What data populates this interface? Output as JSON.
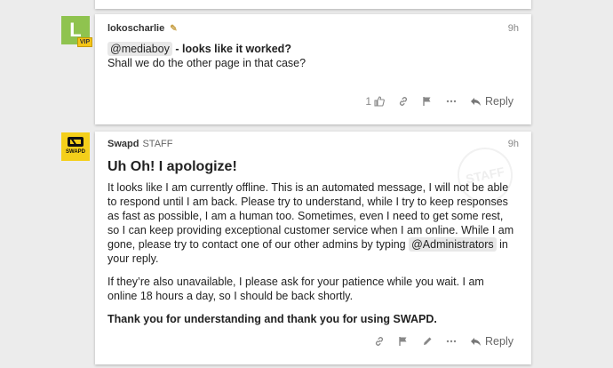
{
  "post1": {
    "avatar_letter": "L",
    "vip_badge": "VIP",
    "username": "lokoscharlie",
    "time": "9h",
    "mention": "@mediaboy",
    "line1_rest": " - looks like it worked?",
    "line2": "Shall we do the other page in that case?",
    "like_count": "1",
    "reply_label": "Reply"
  },
  "post2": {
    "avatar_brand": "SWAPD",
    "username": "Swapd",
    "role": "STAFF",
    "time": "9h",
    "watermark": "STAFF",
    "heading": "Uh Oh! I apologize!",
    "para1_before": "It looks like I am currently offline. This is an automated message, I will not be able to respond until I am back. Please try to understand, while I try to keep responses as fast as possible, I am a human too. Sometimes, even I need to get some rest, so I can keep providing exceptional customer service when I am online. While I am gone, please try to contact one of our other admins by typing ",
    "para1_mention": "@Administrators",
    "para1_after": " in your reply.",
    "para2": "If they’re also unavailable, I please ask for your patience while you wait. I am online 18 hours a day, so I should be back shortly.",
    "para3": "Thank you for understanding and thank you for using SWAPD.",
    "reply_label": "Reply"
  },
  "icons": [
    "like-icon",
    "link-icon",
    "flag-icon",
    "more-icon",
    "reply-icon",
    "edit-icon"
  ]
}
